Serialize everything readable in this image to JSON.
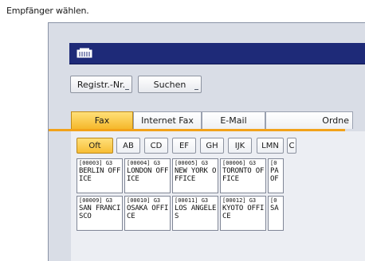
{
  "instruction": "Empfänger wählen.",
  "toolbar": {
    "regnr_label": "Registr.-Nr.",
    "search_label": "Suchen"
  },
  "tabs": [
    {
      "label": "Fax",
      "active": true
    },
    {
      "label": "Internet Fax",
      "active": false
    },
    {
      "label": "E-Mail",
      "active": false
    },
    {
      "label": "Ordne",
      "active": false
    }
  ],
  "filters": [
    {
      "label": "Oft",
      "active": true
    },
    {
      "label": "AB",
      "active": false
    },
    {
      "label": "CD",
      "active": false
    },
    {
      "label": "EF",
      "active": false
    },
    {
      "label": "GH",
      "active": false
    },
    {
      "label": "IJK",
      "active": false
    },
    {
      "label": "LMN",
      "active": false
    },
    {
      "label": "C",
      "active": false
    }
  ],
  "destinations": [
    {
      "code": "[00003] G3",
      "name": "BERLIN OFFICE"
    },
    {
      "code": "[00004] G3",
      "name": "LONDON OFFICE"
    },
    {
      "code": "[00005] G3",
      "name": "NEW YORK OFFICE"
    },
    {
      "code": "[00006] G3",
      "name": "TORONTO OFFICE"
    },
    {
      "code": "[0",
      "name": "PA OF"
    },
    {
      "code": "[00009] G3",
      "name": "SAN FRANCISCO"
    },
    {
      "code": "[00010] G3",
      "name": "OSAKA OFFICE"
    },
    {
      "code": "[00011] G3",
      "name": "LOS ANGELES"
    },
    {
      "code": "[00012] G3",
      "name": "KYOTO OFFICE"
    },
    {
      "code": "[0",
      "name": "SA"
    }
  ],
  "colors": {
    "active_tab": "#f5b82b",
    "title_bar": "#1e2a78"
  }
}
